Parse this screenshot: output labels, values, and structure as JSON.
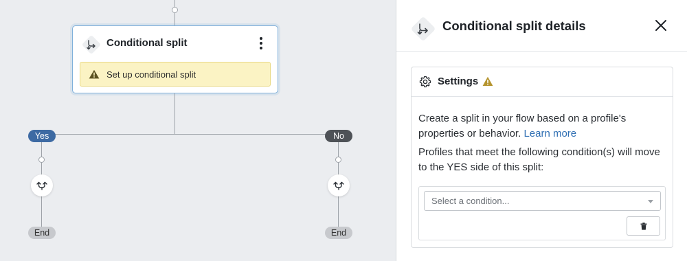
{
  "canvas": {
    "node": {
      "title": "Conditional split",
      "icon": "split-icon",
      "warning_text": "Set up conditional split"
    },
    "branches": {
      "yes_label": "Yes",
      "no_label": "No",
      "end_label_left": "End",
      "end_label_right": "End"
    }
  },
  "panel": {
    "title": "Conditional split details",
    "settings": {
      "heading": "Settings",
      "description": "Create a split in your flow based on a profile's properties or behavior.",
      "learn_more": "Learn more",
      "condition_intro": "Profiles that meet the following condition(s) will move to the YES side of this split:",
      "select_placeholder": "Select a condition..."
    }
  },
  "colors": {
    "canvas_bg": "#ebedf0",
    "yes_pill": "#3d6aa3",
    "no_pill": "#4e5257",
    "warning_bg": "#fbf3c4",
    "link": "#2f6fb3",
    "selected_border": "#7fb0db"
  }
}
